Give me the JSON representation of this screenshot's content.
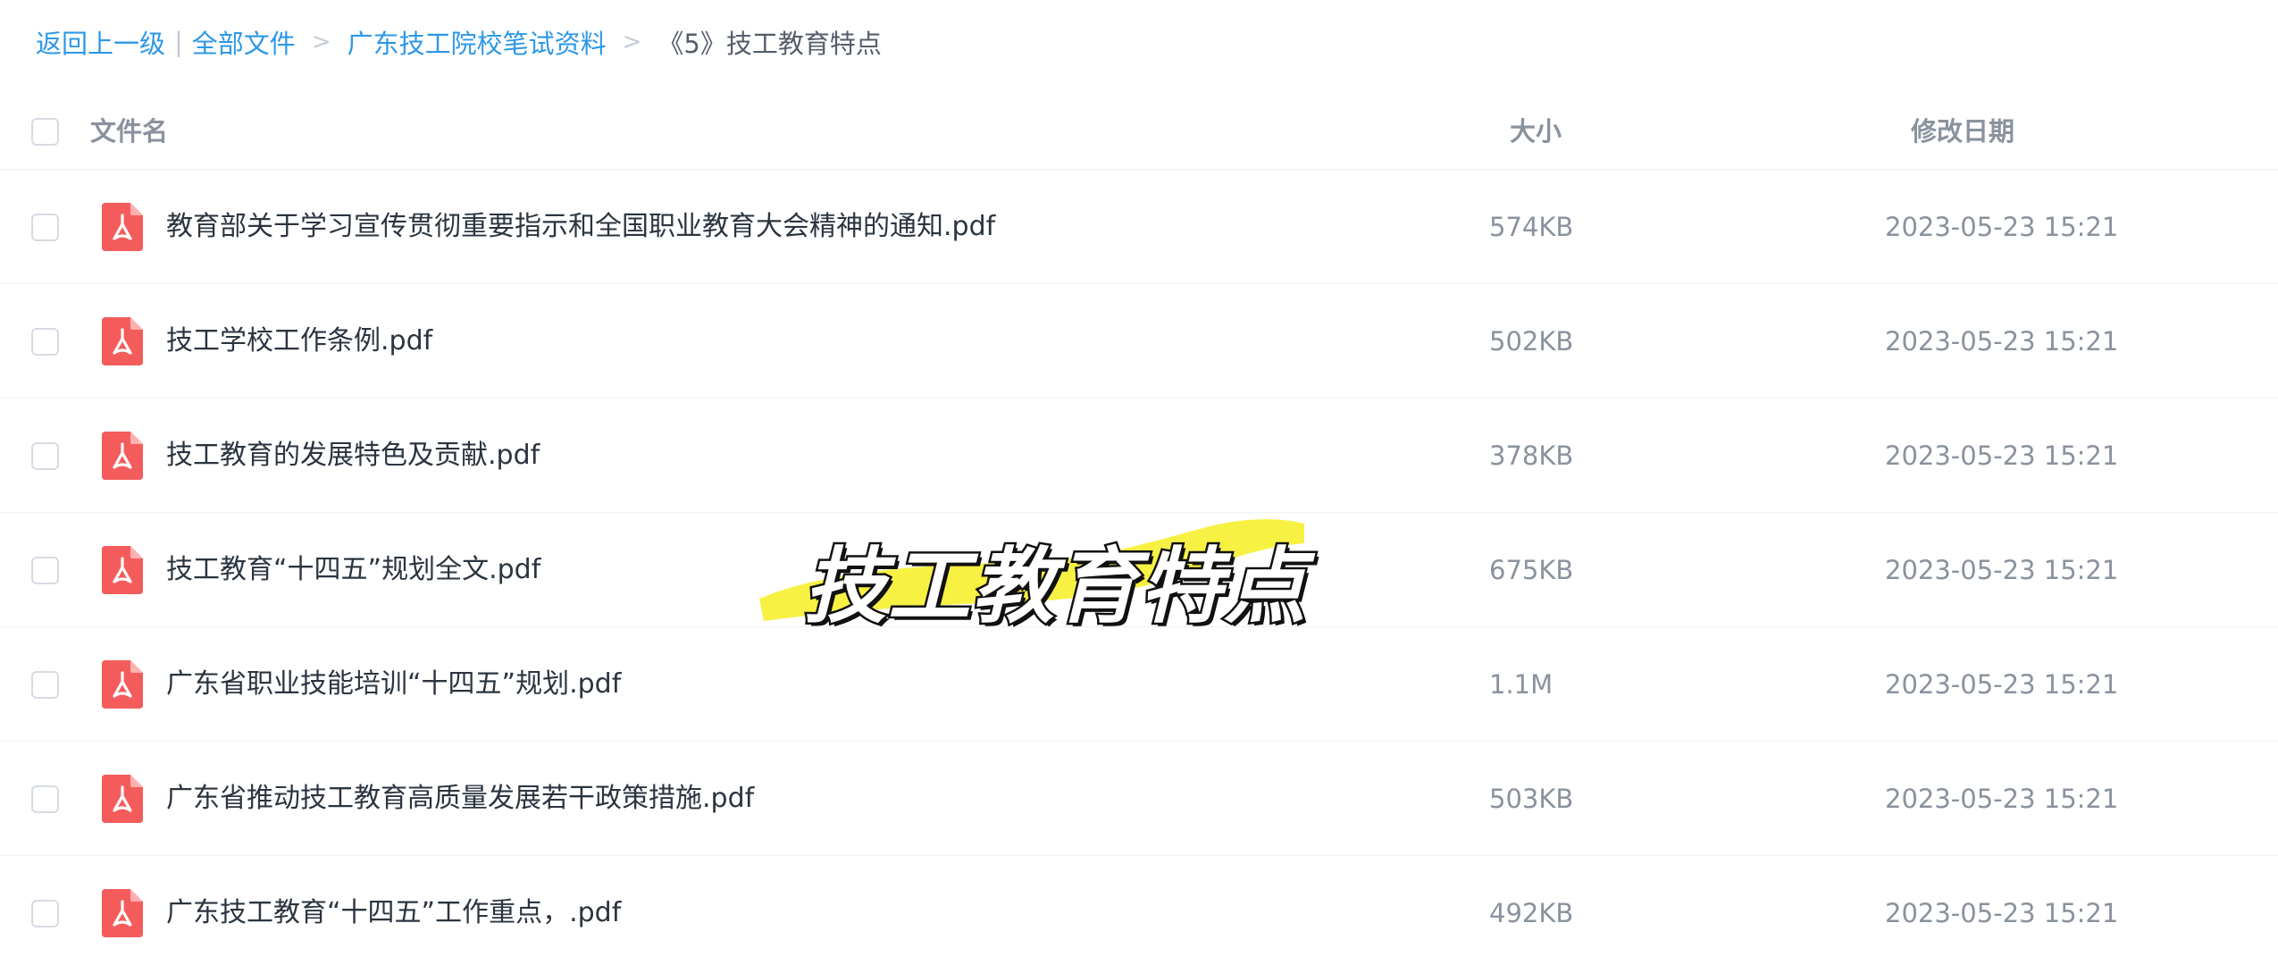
{
  "breadcrumb": {
    "back": "返回上一级",
    "pipe": "|",
    "all_files": "全部文件",
    "sep": ">",
    "folder": "广东技工院校笔试资料",
    "current": "《5》技工教育特点"
  },
  "table": {
    "headers": {
      "name": "文件名",
      "size": "大小",
      "date": "修改日期"
    },
    "rows": [
      {
        "name": "教育部关于学习宣传贯彻重要指示和全国职业教育大会精神的通知.pdf",
        "size": "574KB",
        "date": "2023-05-23 15:21"
      },
      {
        "name": "技工学校工作条例.pdf",
        "size": "502KB",
        "date": "2023-05-23 15:21"
      },
      {
        "name": "技工教育的发展特色及贡献.pdf",
        "size": "378KB",
        "date": "2023-05-23 15:21"
      },
      {
        "name": "技工教育“十四五”规划全文.pdf",
        "size": "675KB",
        "date": "2023-05-23 15:21"
      },
      {
        "name": "广东省职业技能培训“十四五”规划.pdf",
        "size": "1.1M",
        "date": "2023-05-23 15:21"
      },
      {
        "name": "广东省推动技工教育高质量发展若干政策措施.pdf",
        "size": "503KB",
        "date": "2023-05-23 15:21"
      },
      {
        "name": "广东技工教育“十四五”工作重点，.pdf",
        "size": "492KB",
        "date": "2023-05-23 15:21"
      }
    ]
  },
  "icons": {
    "file_type": "pdf-file-icon",
    "pdf_color": "#f45c5c"
  },
  "overlay": {
    "text": "技工教育特点",
    "highlight_color": "#f7f03a"
  },
  "colors": {
    "link": "#2d98e6",
    "muted": "#8a929e",
    "text": "#2b3440"
  }
}
